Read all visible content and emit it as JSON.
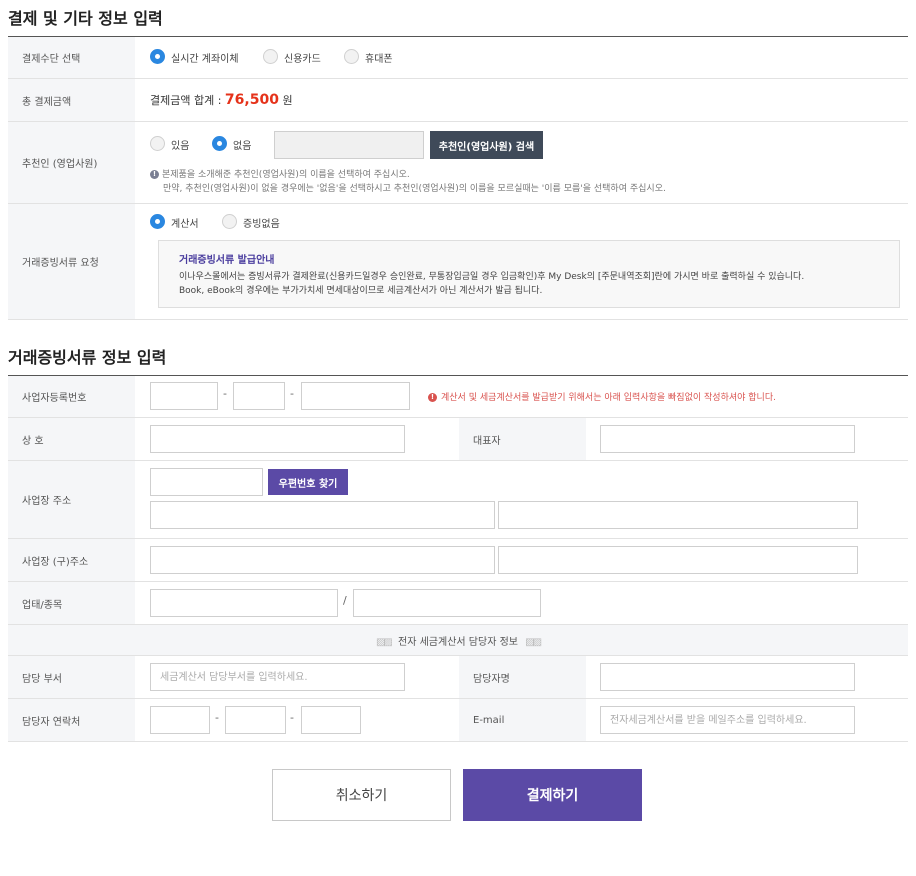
{
  "payment_section": {
    "title": "결제 및 기타 정보 입력",
    "method": {
      "label": "결제수단 선택",
      "options": [
        "실시간 계좌이체",
        "신용카드",
        "휴대폰"
      ],
      "selected": 0
    },
    "total": {
      "label": "총 결제금액",
      "prefix": "결제금액 합계 :",
      "amount": "76,500",
      "unit": "원",
      "accent_color": "#e5321a"
    },
    "recommender": {
      "label": "추천인 (영업사원)",
      "options": [
        "있음",
        "없음"
      ],
      "selected": 1,
      "search_button": "추천인(영업사원) 검색",
      "note1": "본제품을 소개해준 추천인(영업사원)의 이름을 선택하여 주십시오.",
      "note2": "만약, 추천인(영업사원)이 없을 경우에는 '없음'을 선택하시고 추천인(영업사원)의 이름을 모르실때는 '이름 모름'을 선택하여 주십시오."
    },
    "receipt": {
      "label": "거래증빙서류 요청",
      "options": [
        "계산서",
        "증빙없음"
      ],
      "selected": 0,
      "guide_title": "거래증빙서류 발급안내",
      "guide_line1": "이나우스몰에서는 증빙서류가 결제완료(신용카드일경우 승인완료, 무통장입금일 경우 입금확인)후 My Desk의 [주문내역조회]란에 가시면 바로 출력하실 수 있습니다.",
      "guide_line2": "Book, eBook의 경우에는 부가가치세 면세대상이므로 세금계산서가 아닌 계산서가 발급 됩니다.",
      "guide_title_color": "#4a3d9e"
    }
  },
  "receipt_section": {
    "title": "거래증빙서류 정보 입력",
    "business_number": {
      "label": "사업자등록번호",
      "dash": "-",
      "warning": "계산서 및 세금계산서를 발급받기 위해서는 아래 입력사항을 빠짐없이 작성하셔야 합니다.",
      "warning_color": "#d9534f"
    },
    "company": {
      "label": "상 호"
    },
    "ceo": {
      "label": "대표자"
    },
    "address": {
      "label": "사업장 주소",
      "zip_button": "우편번호 찾기"
    },
    "old_address": {
      "label": "사업장 (구)주소"
    },
    "business_type": {
      "label": "업태/종목",
      "slash": "/"
    },
    "manager_header": "전자 세금계산서 담당자 정보",
    "department": {
      "label": "담당 부서",
      "placeholder": "세금계산서 담당부서를 입력하세요."
    },
    "manager_name": {
      "label": "담당자명"
    },
    "contact": {
      "label": "담당자 연락처",
      "dash": "-"
    },
    "email": {
      "label": "E-mail",
      "placeholder": "전자세금계산서를 받을 메일주소를 입력하세요."
    }
  },
  "buttons": {
    "cancel": "취소하기",
    "pay": "결제하기",
    "pay_color": "#5b4aa6"
  }
}
